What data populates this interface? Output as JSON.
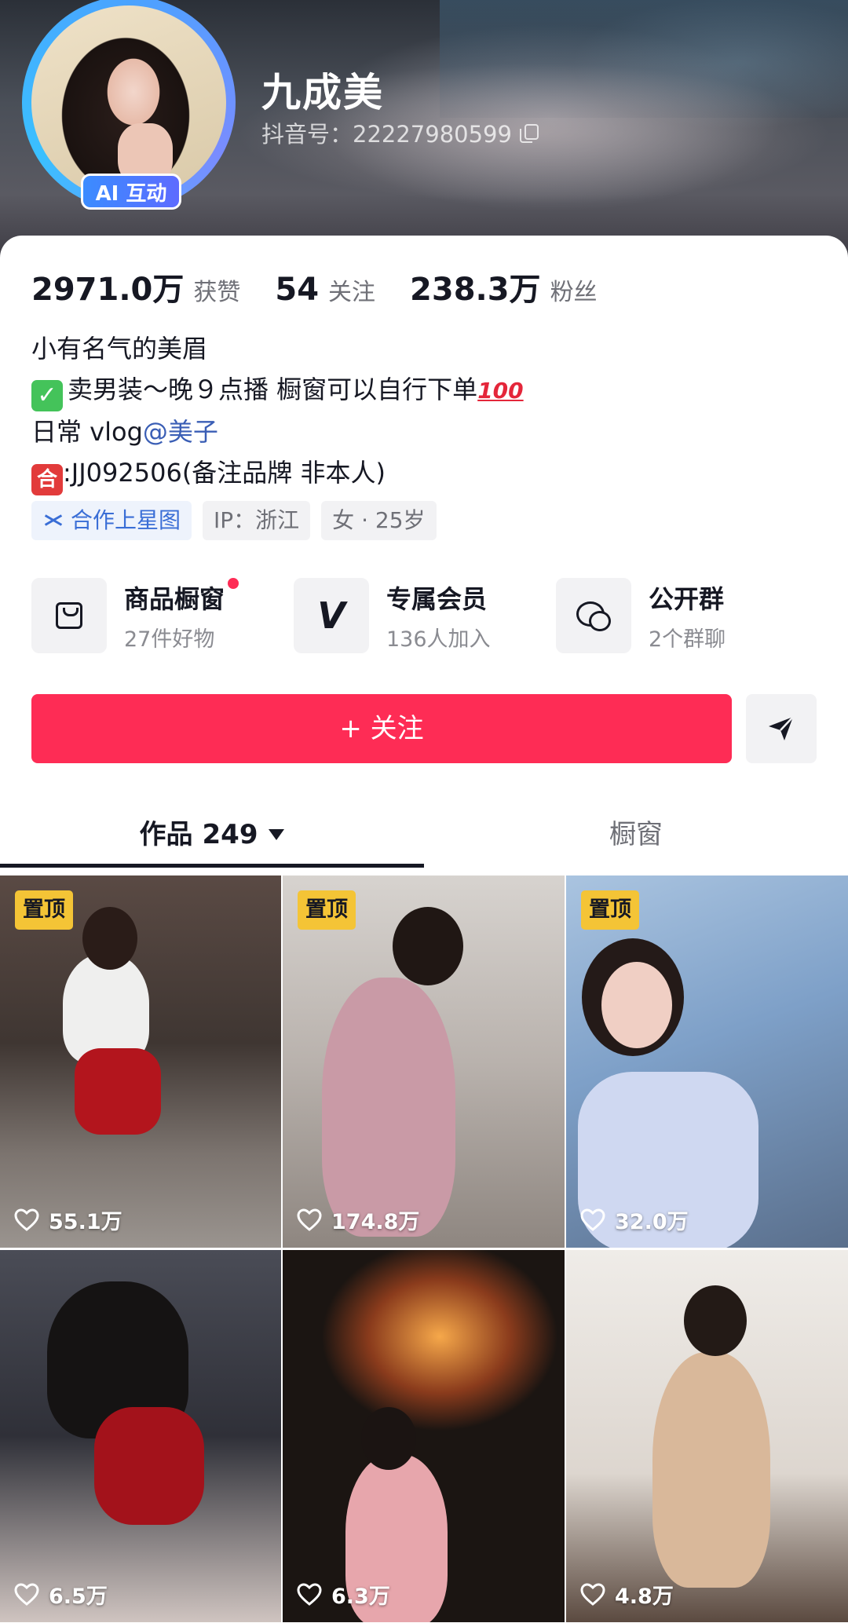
{
  "profile": {
    "nickname": "九成美",
    "douyin_id": "抖音号：22227980599",
    "ai_badge": "AI 互动"
  },
  "stats": [
    {
      "value": "2971.0万",
      "label": "获赞"
    },
    {
      "value": "54",
      "label": "关注"
    },
    {
      "value": "238.3万",
      "label": "粉丝"
    }
  ],
  "bio": {
    "line1": "小有名气的美眉",
    "line2_check": "✓",
    "line2": "卖男装～晚９点播 橱窗可以自行下单",
    "line2_hundred": "100",
    "line3_prefix": "日常 vlog",
    "line3_mention": "@美子",
    "line4_emoji": "合",
    "line4": ":JJ092506(备注品牌 非本人)"
  },
  "tags": [
    {
      "label": "合作上星图",
      "icon": "xingtu-star-icon"
    },
    {
      "label": "IP：浙江"
    },
    {
      "label": "女 · 25岁"
    }
  ],
  "features": [
    {
      "title": "商品橱窗",
      "sub": "27件好物",
      "icon": "shopping-bag-icon",
      "dot": true
    },
    {
      "title": "专属会员",
      "sub": "136人加入",
      "icon": "vip-v-icon"
    },
    {
      "title": "公开群",
      "sub": "2个群聊",
      "icon": "group-chat-icon"
    }
  ],
  "actions": {
    "follow_label": "+ 关注",
    "share_icon": "send-arrow-icon"
  },
  "tabs": {
    "works_label": "作品",
    "works_count": "249",
    "showcase_label": "橱窗"
  },
  "pin_label": "置顶",
  "videos": [
    {
      "likes": "55.1万",
      "pinned": true
    },
    {
      "likes": "174.8万",
      "pinned": true
    },
    {
      "likes": "32.0万",
      "pinned": true
    },
    {
      "likes": "6.5万",
      "pinned": false
    },
    {
      "likes": "6.3万",
      "pinned": false
    },
    {
      "likes": "4.8万",
      "pinned": false
    }
  ],
  "colors": {
    "accent": "#fe2c55",
    "pin_badge": "#f4c436",
    "mention": "#3a5eb5",
    "xingtu": "#3a6ed6"
  }
}
